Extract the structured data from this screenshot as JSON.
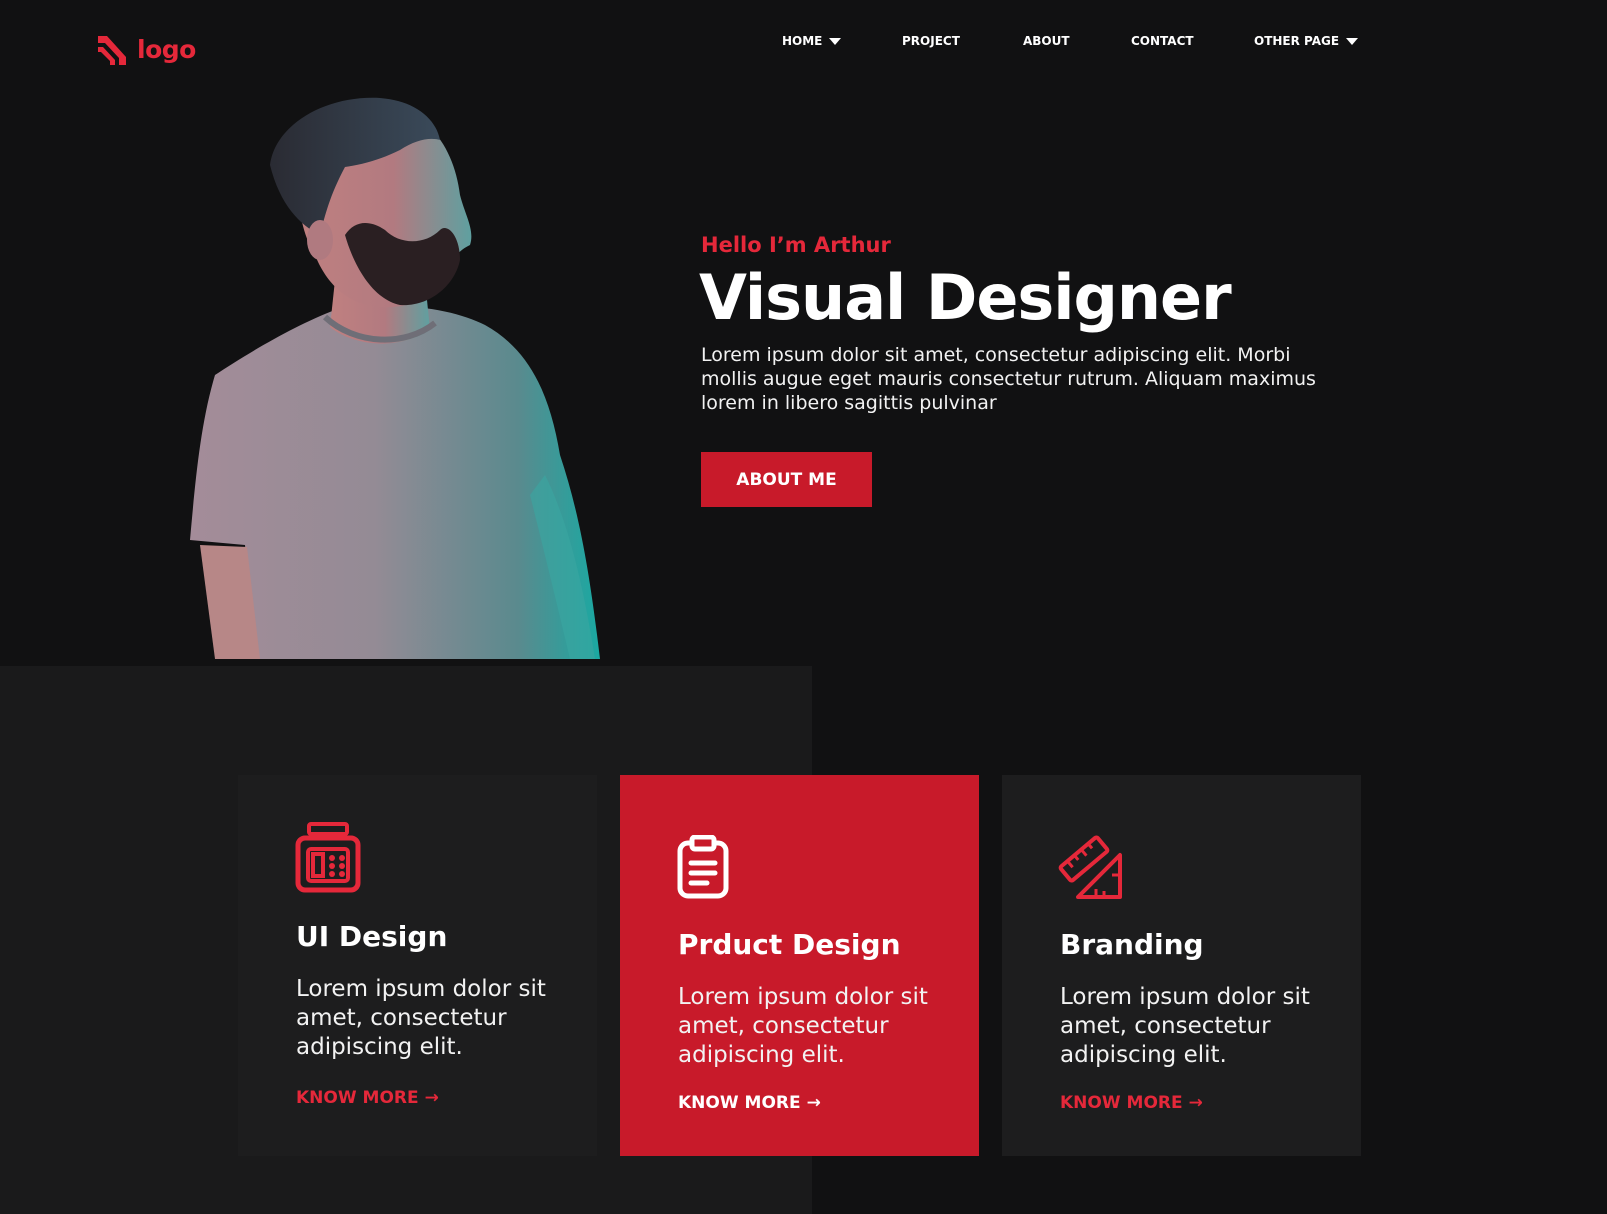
{
  "brand": {
    "logo_text": "logo",
    "accent": "#e5283a",
    "button_red": "#c81a2a"
  },
  "nav": {
    "items": [
      {
        "label": "HOME",
        "dropdown": true
      },
      {
        "label": "PROJECT"
      },
      {
        "label": "ABOUT"
      },
      {
        "label": "CONTACT"
      },
      {
        "label": "OTHER PAGE",
        "dropdown": true
      }
    ]
  },
  "hero": {
    "greeting": "Hello I’m Arthur",
    "title": "Visual Designer",
    "description": "Lorem ipsum dolor sit amet, consectetur adipiscing elit. Morbi mollis augue eget mauris consectetur rutrum. Aliquam maximus lorem in libero sagittis pulvinar",
    "button_label": "ABOUT ME",
    "photo": "portrait-photo"
  },
  "services": [
    {
      "icon": "device-pencil-icon",
      "title": "UI Design",
      "description": "Lorem ipsum dolor sit amet, consectetur adipiscing elit.",
      "link": "KNOW MORE"
    },
    {
      "icon": "clipboard-icon",
      "title": "Prduct Design",
      "description": "Lorem ipsum dolor sit amet, consectetur adipiscing elit.",
      "link": "KNOW MORE"
    },
    {
      "icon": "ruler-triangle-icon",
      "title": "Branding",
      "description": "Lorem ipsum dolor sit amet, consectetur adipiscing elit.",
      "link": "KNOW MORE"
    }
  ]
}
